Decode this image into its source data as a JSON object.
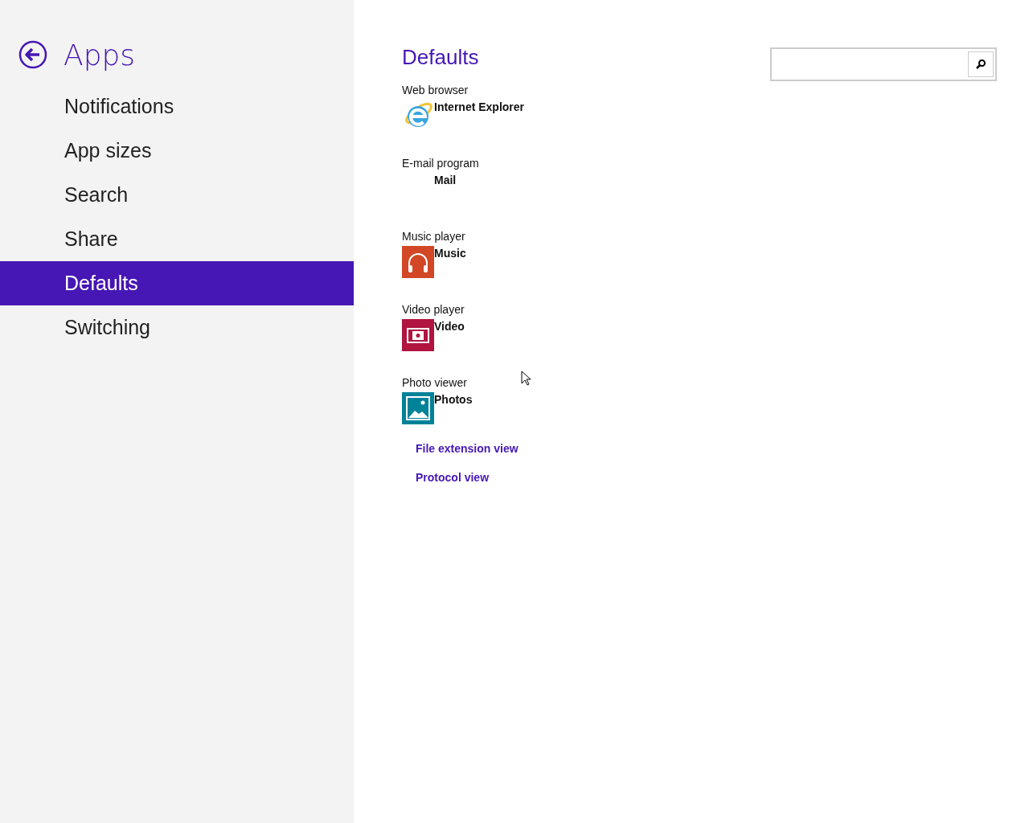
{
  "sidebar": {
    "title": "Apps",
    "items": [
      {
        "label": "Notifications",
        "selected": false
      },
      {
        "label": "App sizes",
        "selected": false
      },
      {
        "label": "Search",
        "selected": false
      },
      {
        "label": "Share",
        "selected": false
      },
      {
        "label": "Defaults",
        "selected": true
      },
      {
        "label": "Switching",
        "selected": false
      }
    ]
  },
  "main": {
    "heading": "Defaults",
    "defaults": [
      {
        "category": "Web browser",
        "app": "Internet Explorer",
        "kind": "browser"
      },
      {
        "category": "E-mail program",
        "app": "Mail",
        "kind": "none"
      },
      {
        "category": "Music player",
        "app": "Music",
        "kind": "music"
      },
      {
        "category": "Video player",
        "app": "Video",
        "kind": "video"
      },
      {
        "category": "Photo viewer",
        "app": "Photos",
        "kind": "photos"
      }
    ],
    "links": [
      "File extension view",
      "Protocol view"
    ]
  }
}
